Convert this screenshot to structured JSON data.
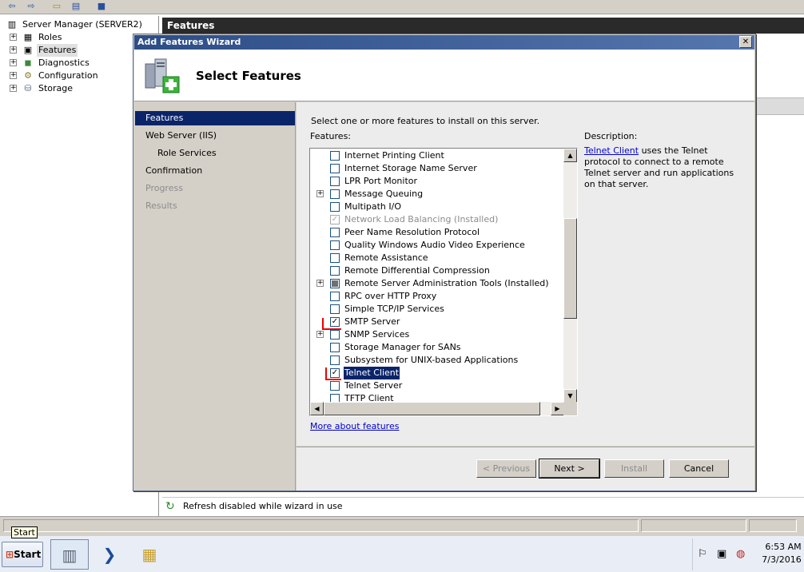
{
  "server_manager": {
    "tree_root": "Server Manager (SERVER2)",
    "tree_items": [
      "Roles",
      "Features",
      "Diagnostics",
      "Configuration",
      "Storage"
    ],
    "right_pane_title": "Features",
    "refresh_status": "Refresh disabled while wizard in use"
  },
  "wizard": {
    "window_title": "Add Features Wizard",
    "close_glyph": "✕",
    "header_title": "Select Features",
    "nav": [
      "Features",
      "Web Server (IIS)",
      "Role Services",
      "Confirmation",
      "Progress",
      "Results"
    ],
    "instruction": "Select one or more features to install on this server.",
    "features_label": "Features:",
    "features": [
      {
        "label": "Internet Printing Client",
        "state": "unchecked",
        "expand": false
      },
      {
        "label": "Internet Storage Name Server",
        "state": "unchecked",
        "expand": false
      },
      {
        "label": "LPR Port Monitor",
        "state": "unchecked",
        "expand": false
      },
      {
        "label": "Message Queuing",
        "state": "unchecked",
        "expand": true
      },
      {
        "label": "Multipath I/O",
        "state": "unchecked",
        "expand": false
      },
      {
        "label": "Network Load Balancing  (Installed)",
        "state": "installed",
        "expand": false
      },
      {
        "label": "Peer Name Resolution Protocol",
        "state": "unchecked",
        "expand": false
      },
      {
        "label": "Quality Windows Audio Video Experience",
        "state": "unchecked",
        "expand": false
      },
      {
        "label": "Remote Assistance",
        "state": "unchecked",
        "expand": false
      },
      {
        "label": "Remote Differential Compression",
        "state": "unchecked",
        "expand": false
      },
      {
        "label": "Remote Server Administration Tools  (Installed)",
        "state": "partial",
        "expand": true
      },
      {
        "label": "RPC over HTTP Proxy",
        "state": "unchecked",
        "expand": false
      },
      {
        "label": "Simple TCP/IP Services",
        "state": "unchecked",
        "expand": false
      },
      {
        "label": "SMTP Server",
        "state": "checked",
        "expand": false
      },
      {
        "label": "SNMP Services",
        "state": "unchecked",
        "expand": true
      },
      {
        "label": "Storage Manager for SANs",
        "state": "unchecked",
        "expand": false
      },
      {
        "label": "Subsystem for UNIX-based Applications",
        "state": "unchecked",
        "expand": false
      },
      {
        "label": "Telnet Client",
        "state": "checked",
        "expand": false,
        "selected": true
      },
      {
        "label": "Telnet Server",
        "state": "unchecked",
        "expand": false
      },
      {
        "label": "TFTP Client",
        "state": "unchecked",
        "expand": false
      }
    ],
    "description_label": "Description:",
    "description_link": "Telnet Client",
    "description_text": " uses the Telnet protocol to connect to a remote Telnet server and run applications on that server.",
    "more_link": "More about features",
    "buttons": {
      "previous": "< Previous",
      "next": "Next >",
      "install": "Install",
      "cancel": "Cancel"
    }
  },
  "taskbar": {
    "tooltip": "Start",
    "start_label": "Start",
    "clock_time": "6:53 AM",
    "clock_date": "7/3/2016"
  },
  "colors": {
    "title_bar": "#2c4d86",
    "selection": "#0a246a",
    "link": "#0000cc",
    "annotation": "#e00000"
  }
}
